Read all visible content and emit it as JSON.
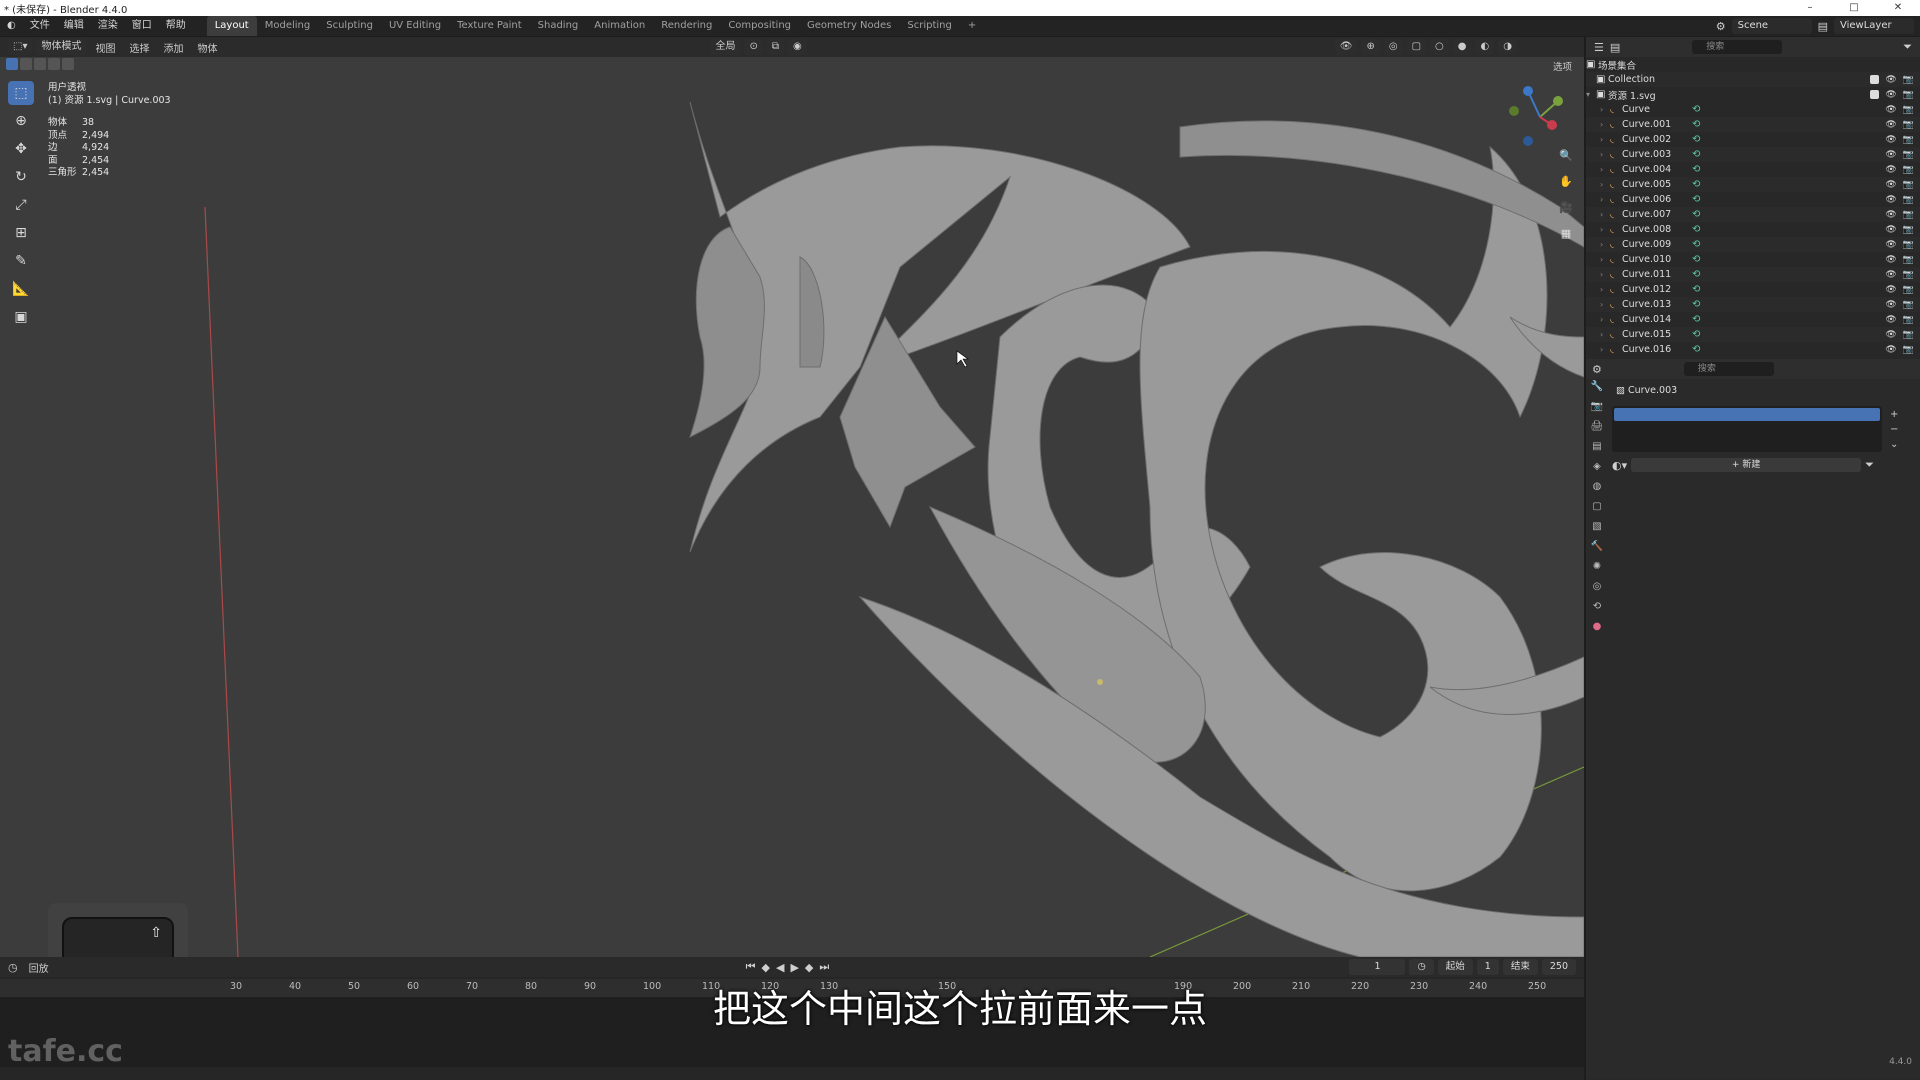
{
  "window": {
    "title": "* (未保存) - Blender 4.4.0",
    "controls": [
      "–",
      "□",
      "✕"
    ]
  },
  "menu": [
    "文件",
    "编辑",
    "渲染",
    "窗口",
    "帮助"
  ],
  "workspaces": [
    "Layout",
    "Modeling",
    "Sculpting",
    "UV Editing",
    "Texture Paint",
    "Shading",
    "Animation",
    "Rendering",
    "Compositing",
    "Geometry Nodes",
    "Scripting",
    "+"
  ],
  "top_right": {
    "scene": "Scene",
    "view_layer": "ViewLayer"
  },
  "viewport": {
    "mode": "物体模式",
    "menus": [
      "视图",
      "选择",
      "添加",
      "物体"
    ],
    "transform": "全局",
    "options_label": "选项",
    "view_name": "用户透视",
    "object_info": "(1) 资源 1.svg | Curve.003",
    "stats": [
      {
        "k": "物体",
        "v": "38"
      },
      {
        "k": "顶点",
        "v": "2,494"
      },
      {
        "k": "边",
        "v": "4,924"
      },
      {
        "k": "面",
        "v": "2,454"
      },
      {
        "k": "三角形",
        "v": "2,454"
      }
    ]
  },
  "tools": [
    "select-icon",
    "cursor-icon",
    "move-icon",
    "rotate-icon",
    "scale-icon",
    "transform-icon",
    "annotate-icon",
    "measure-icon",
    "add-cube-icon"
  ],
  "shift_key": {
    "arrow": "⇧",
    "label": "shift"
  },
  "timeline": {
    "label": "回放",
    "current_frame": "1",
    "start_label": "起始",
    "start": "1",
    "end_label": "结束",
    "end": "250",
    "ticks": [
      "30",
      "40",
      "50",
      "60",
      "70",
      "80",
      "90",
      "100",
      "110",
      "120",
      "130",
      "150",
      "190",
      "200",
      "210",
      "220",
      "230",
      "240",
      "250"
    ]
  },
  "subtitle": "把这个中间这个拉前面来一点",
  "watermark": "tafe.cc",
  "outliner": {
    "search_placeholder": "搜索",
    "root": "场景集合",
    "collection": "Collection",
    "svg_collection": "资源 1.svg",
    "items": [
      "Curve",
      "Curve.001",
      "Curve.002",
      "Curve.003",
      "Curve.004",
      "Curve.005",
      "Curve.006",
      "Curve.007",
      "Curve.008",
      "Curve.009",
      "Curve.010",
      "Curve.011",
      "Curve.012",
      "Curve.013",
      "Curve.014",
      "Curve.015",
      "Curve.016"
    ]
  },
  "properties": {
    "search_placeholder": "搜索",
    "object_name": "Curve.003",
    "new_button": "新建"
  },
  "version": "4.4.0",
  "colors": {
    "accent": "#4772b3",
    "viewport": "#3c3c3c",
    "shape": "#9a9a9a"
  }
}
